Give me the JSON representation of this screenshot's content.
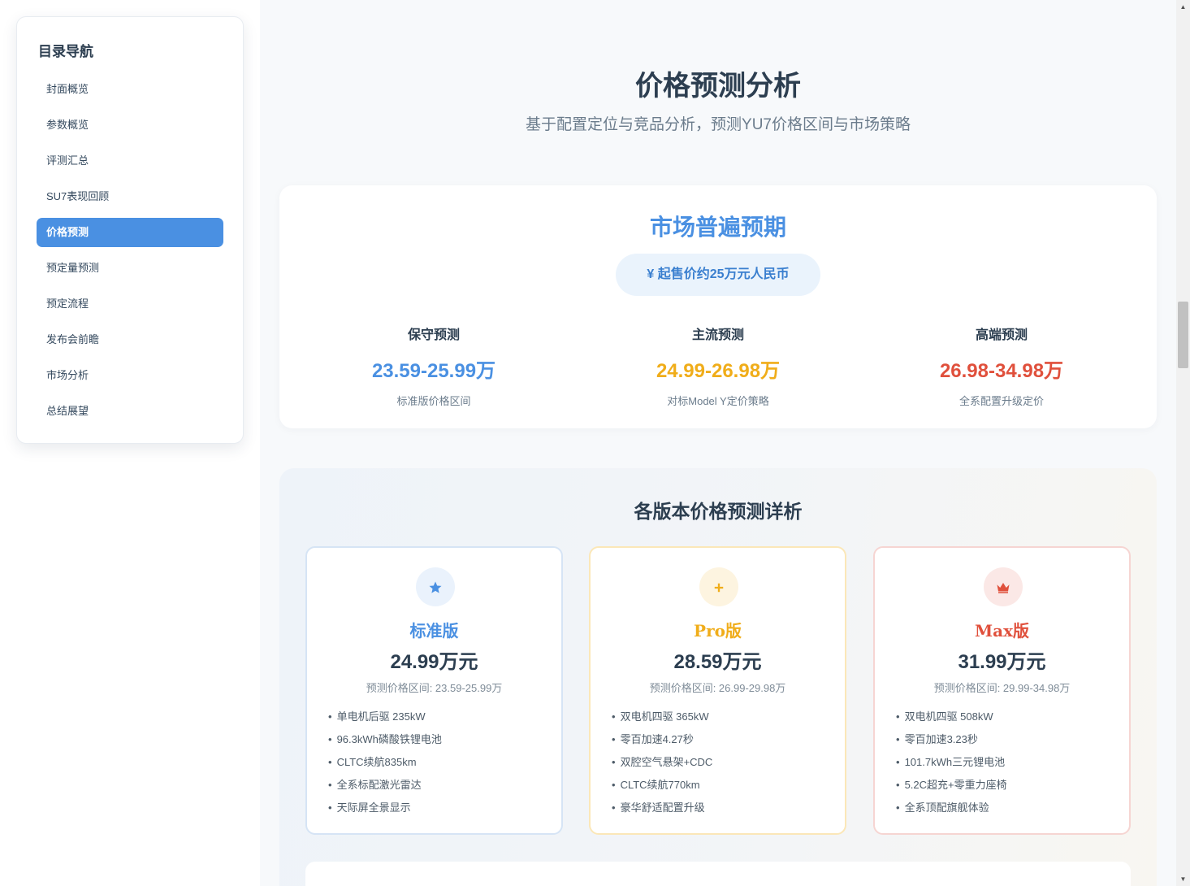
{
  "sidebar": {
    "title": "目录导航",
    "items": [
      {
        "label": "封面概览"
      },
      {
        "label": "参数概览"
      },
      {
        "label": "评测汇总"
      },
      {
        "label": "SU7表现回顾"
      },
      {
        "label": "价格预测",
        "active": true
      },
      {
        "label": "预定量预测"
      },
      {
        "label": "预定流程"
      },
      {
        "label": "发布会前瞻"
      },
      {
        "label": "市场分析"
      },
      {
        "label": "总结展望"
      }
    ]
  },
  "header": {
    "title": "价格预测分析",
    "subtitle": "基于配置定位与竞品分析，预测YU7价格区间与市场策略"
  },
  "expectation": {
    "title": "市场普遍预期",
    "badge": "¥ 起售价约25万元人民币",
    "forecasts": [
      {
        "label": "保守预测",
        "value": "23.59-25.99万",
        "desc": "标准版价格区间",
        "color": "#4a90e2"
      },
      {
        "label": "主流预测",
        "value": "24.99-26.98万",
        "desc": "对标Model Y定价策略",
        "color": "#f0ad1a"
      },
      {
        "label": "高端预测",
        "value": "26.98-34.98万",
        "desc": "全系配置升级定价",
        "color": "#e0503c"
      }
    ]
  },
  "details": {
    "title": "各版本价格预测详析",
    "versions": [
      {
        "name": "标准版",
        "icon": "star-icon",
        "price": "24.99万元",
        "range": "预测价格区间: 23.59-25.99万",
        "accent": "#4a90e2",
        "border": "#d6e4f5",
        "icon_bg": "#eaf2fc",
        "features": [
          "单电机后驱 235kW",
          "96.3kWh磷酸铁锂电池",
          "CLTC续航835km",
          "全系标配激光雷达",
          "天际屏全景显示"
        ]
      },
      {
        "name": "Pro版",
        "icon": "plus-icon",
        "price": "28.59万元",
        "range": "预测价格区间: 26.99-29.98万",
        "accent": "#f0ad1a",
        "border": "#fbe7b8",
        "icon_bg": "#fdf4e0",
        "features": [
          "双电机四驱 365kW",
          "零百加速4.27秒",
          "双腔空气悬架+CDC",
          "CLTC续航770km",
          "豪华舒适配置升级"
        ]
      },
      {
        "name": "Max版",
        "icon": "crown-icon",
        "price": "31.99万元",
        "range": "预测价格区间: 29.99-34.98万",
        "accent": "#e0503c",
        "border": "#f6d5d2",
        "icon_bg": "#fbe8e6",
        "features": [
          "双电机四驱 508kW",
          "零百加速3.23秒",
          "101.7kWh三元锂电池",
          "5.2C超充+零重力座椅",
          "全系顶配旗舰体验"
        ]
      }
    ]
  }
}
